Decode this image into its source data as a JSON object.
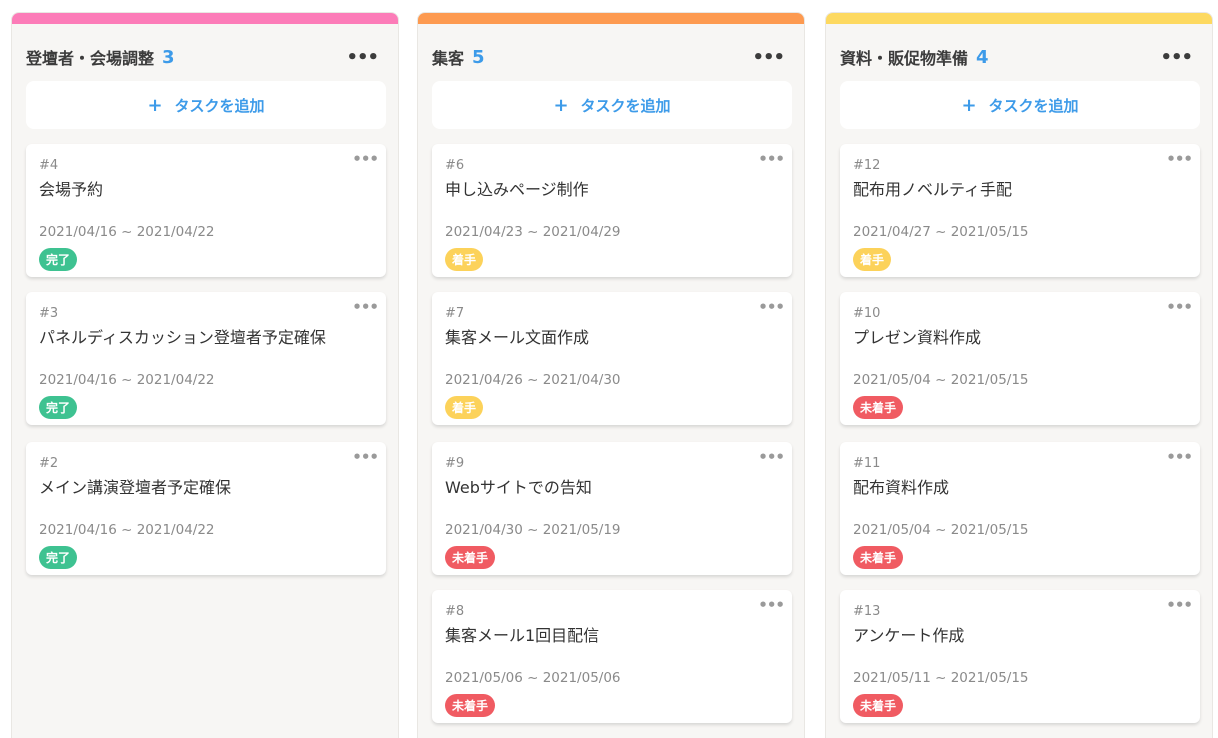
{
  "board": {
    "add_label": "タスクを追加",
    "add_icon": "plus-icon",
    "more_icon": "more-horizontal-icon",
    "status_colors": {
      "完了": "#3ec291",
      "着手": "#fcd25a",
      "未着手": "#f05b62"
    },
    "columns": [
      {
        "title": "登壇者・会場調整",
        "count": "3",
        "color": "#fc7cb8",
        "cards": [
          {
            "number": "#4",
            "title": "会場予約",
            "dates": "2021/04/16 ~ 2021/04/22",
            "status": "完了"
          },
          {
            "number": "#3",
            "title": "パネルディスカッション登壇者予定確保",
            "dates": "2021/04/16 ~ 2021/04/22",
            "status": "完了"
          },
          {
            "number": "#2",
            "title": "メイン講演登壇者予定確保",
            "dates": "2021/04/16 ~ 2021/04/22",
            "status": "完了"
          }
        ]
      },
      {
        "title": "集客",
        "count": "5",
        "color": "#fd9a50",
        "cards": [
          {
            "number": "#6",
            "title": "申し込みページ制作",
            "dates": "2021/04/23 ~ 2021/04/29",
            "status": "着手"
          },
          {
            "number": "#7",
            "title": "集客メール文面作成",
            "dates": "2021/04/26 ~ 2021/04/30",
            "status": "着手"
          },
          {
            "number": "#9",
            "title": "Webサイトでの告知",
            "dates": "2021/04/30 ~ 2021/05/19",
            "status": "未着手"
          },
          {
            "number": "#8",
            "title": "集客メール1回目配信",
            "dates": "2021/05/06 ~ 2021/05/06",
            "status": "未着手"
          }
        ]
      },
      {
        "title": "資料・販促物準備",
        "count": "4",
        "color": "#fdd960",
        "cards": [
          {
            "number": "#12",
            "title": "配布用ノベルティ手配",
            "dates": "2021/04/27 ~ 2021/05/15",
            "status": "着手"
          },
          {
            "number": "#10",
            "title": "プレゼン資料作成",
            "dates": "2021/05/04 ~ 2021/05/15",
            "status": "未着手"
          },
          {
            "number": "#11",
            "title": "配布資料作成",
            "dates": "2021/05/04 ~ 2021/05/15",
            "status": "未着手"
          },
          {
            "number": "#13",
            "title": "アンケート作成",
            "dates": "2021/05/11 ~ 2021/05/15",
            "status": "未着手"
          }
        ]
      }
    ]
  }
}
